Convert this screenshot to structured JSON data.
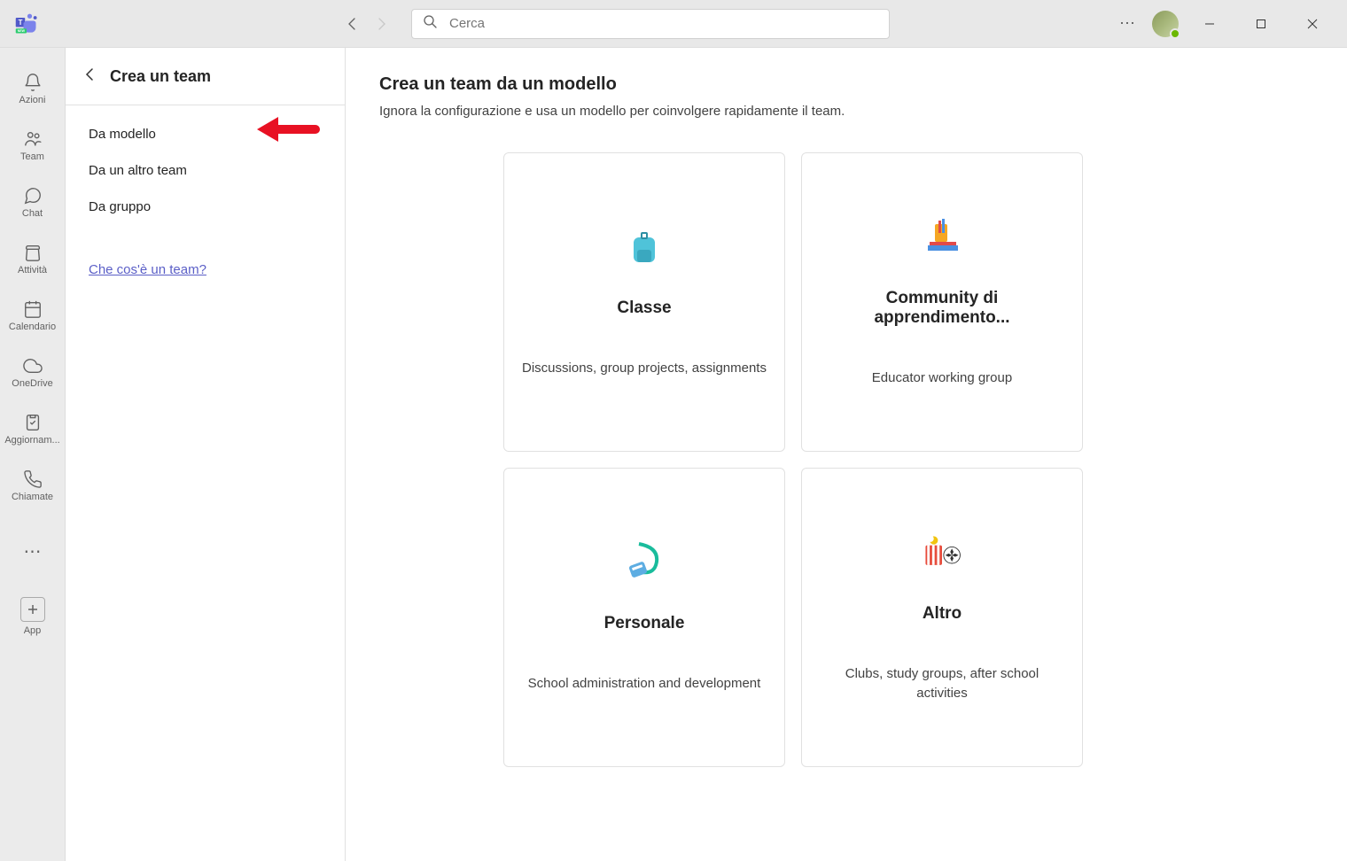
{
  "search": {
    "placeholder": "Cerca"
  },
  "rail": {
    "items": [
      {
        "label": "Azioni",
        "icon": "bell"
      },
      {
        "label": "Team",
        "icon": "team"
      },
      {
        "label": "Chat",
        "icon": "chat"
      },
      {
        "label": "Attività",
        "icon": "assignments"
      },
      {
        "label": "Calendario",
        "icon": "calendar"
      },
      {
        "label": "OneDrive",
        "icon": "cloud"
      },
      {
        "label": "Aggiornam...",
        "icon": "clipboard"
      },
      {
        "label": "Chiamate",
        "icon": "call"
      }
    ],
    "app_label": "App"
  },
  "panel": {
    "title": "Crea un team",
    "menu": [
      "Da modello",
      "Da un altro team",
      "Da gruppo"
    ],
    "help_link": "Che cos'è un team?"
  },
  "content": {
    "title": "Crea un team da un modello",
    "subtitle": "Ignora la configurazione e usa un modello per coinvolgere rapidamente il team.",
    "templates": [
      {
        "icon": "backpack",
        "title": "Classe",
        "description": "Discussions, group projects, assignments"
      },
      {
        "icon": "stationery",
        "title": "Community di apprendimento...",
        "description": "Educator working group"
      },
      {
        "icon": "lanyard",
        "title": "Personale",
        "description": "School administration and development"
      },
      {
        "icon": "popcorn",
        "title": "Altro",
        "description": "Clubs, study groups, after school activities"
      }
    ]
  }
}
